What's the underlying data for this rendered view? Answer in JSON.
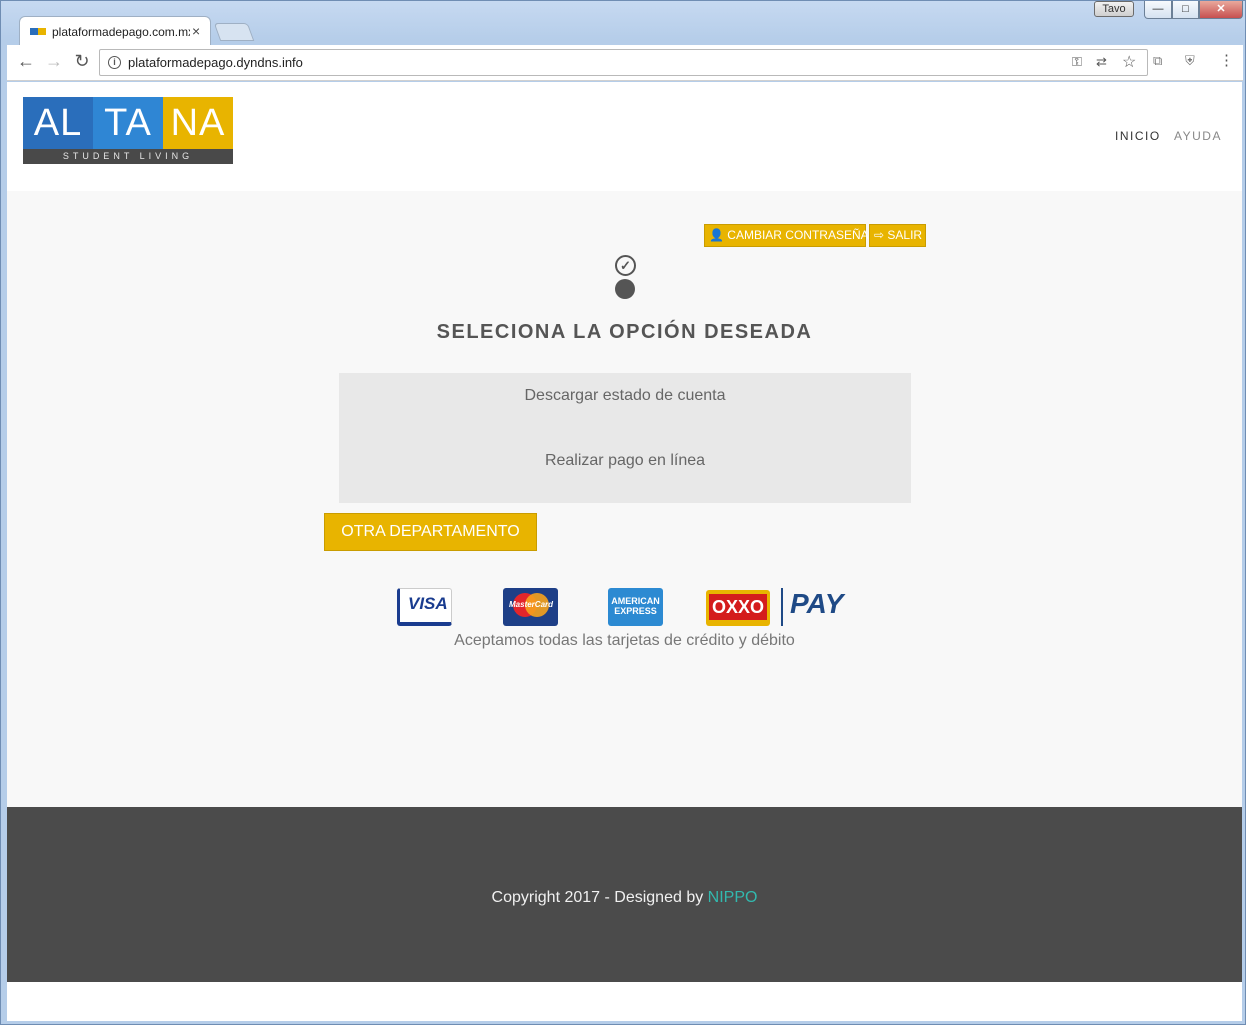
{
  "window": {
    "user_badge": "Tavo",
    "min_glyph": "—",
    "max_glyph": "□",
    "close_glyph": "✕"
  },
  "tab": {
    "title": "plataformadepago.com.mx",
    "close_glyph": "×"
  },
  "toolbar": {
    "back_glyph": "←",
    "forward_glyph": "→",
    "reload_glyph": "↻",
    "url": "plataformadepago.dyndns.info",
    "key_glyph": "⚿",
    "translate_glyph": "⇄",
    "star_glyph": "☆",
    "pdf_glyph": "⧉",
    "shield_glyph": "⛨",
    "menu_glyph": "⋮",
    "info_glyph": "i"
  },
  "logo": {
    "part1": "AL",
    "part2": "TA",
    "part3": "NA",
    "tagline": "STUDENT LIVING"
  },
  "nav": {
    "inicio": "INICIO",
    "ayuda": "AYUDA"
  },
  "actions": {
    "cambiar": "👤 CAMBIAR CONTRASEÑA",
    "salir": "⇨ SALIR"
  },
  "steps": {
    "check_glyph": "✓"
  },
  "main": {
    "title": "SELECIONA LA OPCIÓN DESEADA",
    "option1": "Descargar estado de cuenta",
    "option2": "Realizar pago en línea",
    "otra_button": "OTRA DEPARTAMENTO"
  },
  "payments": {
    "visa": "VISA",
    "mastercard": "MasterCard",
    "amex": "AMERICAN EXPRESS",
    "oxxo": "OXXO",
    "pay": "PAY",
    "accept_text": "Aceptamos todas las tarjetas de crédito y débito"
  },
  "footer": {
    "copyright": "Copyright 2017 - Designed by ",
    "nippo": "NIPPO"
  }
}
